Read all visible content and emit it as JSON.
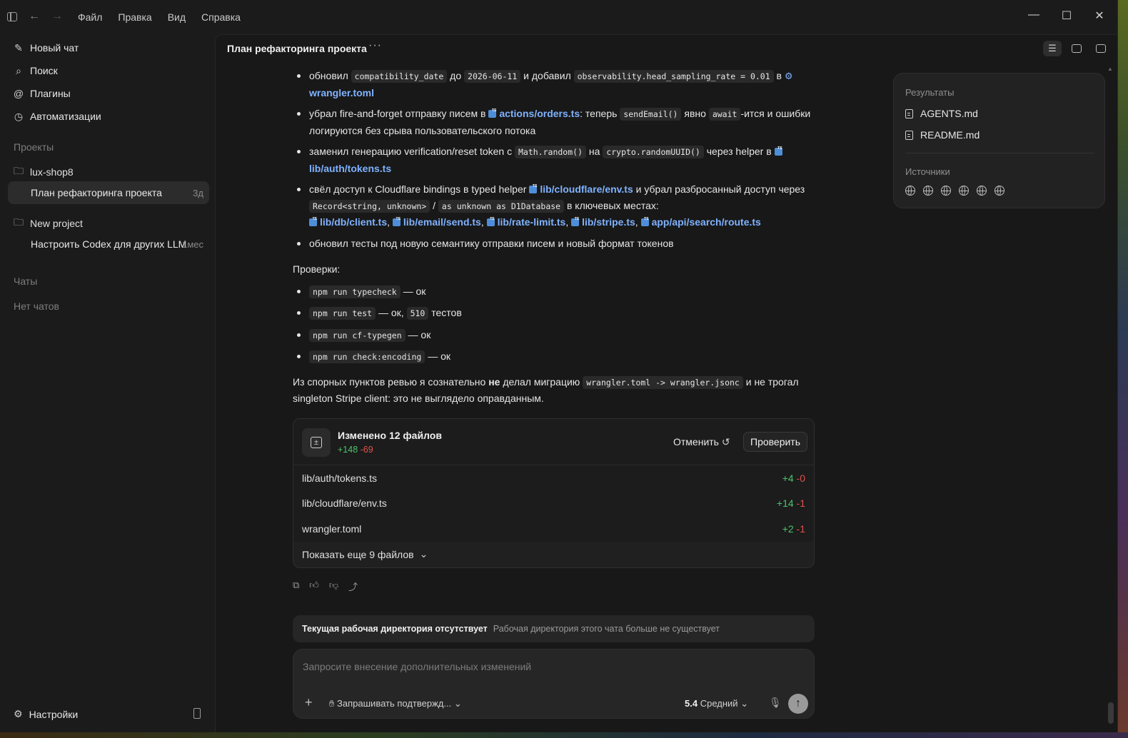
{
  "titlebar": {
    "menu": [
      "Файл",
      "Правка",
      "Вид",
      "Справка"
    ]
  },
  "sidebar": {
    "nav": [
      {
        "label": "Новый чат",
        "icon": "edit-icon"
      },
      {
        "label": "Поиск",
        "icon": "search-icon"
      },
      {
        "label": "Плагины",
        "icon": "at-icon"
      },
      {
        "label": "Автоматизации",
        "icon": "clock-icon"
      }
    ],
    "projects_label": "Проекты",
    "projects": [
      {
        "name": "lux-shop8",
        "chats": [
          {
            "title": "План рефакторинга проекта",
            "age": "3д",
            "active": true
          }
        ]
      },
      {
        "name": "New project",
        "chats": [
          {
            "title": "Настроить Codex для других LLM",
            "age": "1мес"
          }
        ]
      }
    ],
    "chats_label": "Чаты",
    "no_chats": "Нет чатов",
    "settings": "Настройки"
  },
  "header": {
    "title": "План рефакторинга проекта",
    "more": "···"
  },
  "message": {
    "b1": {
      "t1": "обновил",
      "c1": "compatibility_date",
      "t2": "до",
      "c2": "2026-06-11",
      "t3": "и добавил",
      "c3": "observability.head_sampling_rate = 0.01",
      "t4": "в",
      "link": "wrangler.toml"
    },
    "b2": {
      "t1": "убрал fire-and-forget отправку писем в",
      "link": "actions/orders.ts",
      "t2": ": теперь",
      "c1": "sendEmail()",
      "t3": "явно",
      "c2": "await",
      "t4": "-ится и ошибки логируются без срыва пользовательского потока"
    },
    "b3": {
      "t1": "заменил генерацию verification/reset token с",
      "c1": "Math.random()",
      "t2": "на",
      "c2": "crypto.randomUUID()",
      "t3": "через helper в",
      "link": "lib/auth/tokens.ts"
    },
    "b4": {
      "t1": "свёл доступ к Cloudflare bindings в typed helper",
      "link1": "lib/cloudflare/env.ts",
      "t2": "и убрал разбросанный доступ через",
      "c1": "Record<string, unknown>",
      "t3": "/",
      "c2": "as unknown as D1Database",
      "t4": "в ключевых местах:",
      "l2": "lib/db/client.ts",
      "l3": "lib/email/send.ts",
      "l4": "lib/rate-limit.ts",
      "l5": "lib/stripe.ts",
      "l6": "app/api/search/route.ts"
    },
    "b5": "обновил тесты под новую семантику отправки писем и новый формат токенов",
    "checks_label": "Проверки:",
    "checks": [
      {
        "cmd": "npm run typecheck",
        "result": "— ок"
      },
      {
        "cmd": "npm run test",
        "result": "— ок,",
        "num": "510",
        "tail": "тестов"
      },
      {
        "cmd": "npm run cf-typegen",
        "result": "— ок"
      },
      {
        "cmd": "npm run check:encoding",
        "result": "— ок"
      }
    ],
    "final": {
      "t1": "Из спорных пунктов ревью я сознательно",
      "bold": "не",
      "t2": "делал миграцию",
      "code": "wrangler.toml -> wrangler.jsonc",
      "t3": "и не трогал singleton Stripe client: это не выглядело оправданным."
    }
  },
  "files_card": {
    "title": "Изменено 12 файлов",
    "added": "+148",
    "removed": "-69",
    "undo": "Отменить",
    "review": "Проверить",
    "files": [
      {
        "path": "lib/auth/tokens.ts",
        "add": "+4",
        "del": "-0"
      },
      {
        "path": "lib/cloudflare/env.ts",
        "add": "+14",
        "del": "-1"
      },
      {
        "path": "wrangler.toml",
        "add": "+2",
        "del": "-1"
      }
    ],
    "show_more": "Показать еще 9 файлов"
  },
  "notice": {
    "title": "Текущая рабочая директория отсутствует",
    "text": "Рабочая директория этого чата больше не существует"
  },
  "composer": {
    "placeholder": "Запросите внесение дополнительных изменений",
    "permission": "Запрашивать подтвержд...",
    "model_version": "5.4",
    "model_effort": "Средний"
  },
  "right_panel": {
    "results_label": "Результаты",
    "files": [
      "AGENTS.md",
      "README.md"
    ],
    "sources_label": "Источники",
    "sources_count": 6
  }
}
